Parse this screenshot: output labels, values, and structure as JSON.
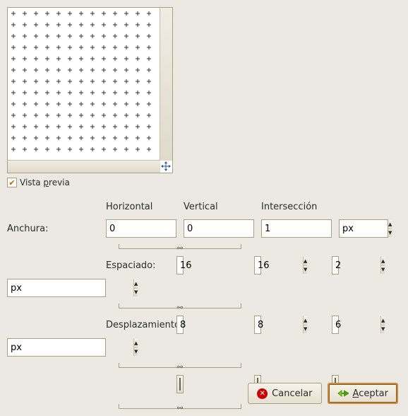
{
  "preview": {
    "checkbox_label_pre": "Vista ",
    "checkbox_label_underlined": "p",
    "checkbox_label_post": "revia",
    "checked": true
  },
  "columns": {
    "horizontal": "Horizontal",
    "vertical": "Vertical",
    "intersection": "Intersección"
  },
  "rows": {
    "width": {
      "label": "Anchura:",
      "horizontal": "0",
      "vertical": "0",
      "intersection": "1",
      "unit": "px"
    },
    "spacing": {
      "label": "Espaciado:",
      "horizontal": "16",
      "vertical": "16",
      "intersection": "2",
      "unit": "px"
    },
    "offset": {
      "label": "Desplazamiento:",
      "horizontal": "8",
      "vertical": "8",
      "intersection": "6",
      "unit": "px"
    }
  },
  "colors": {
    "horizontal": "#000000",
    "vertical": "#000000",
    "intersection": "#000000"
  },
  "buttons": {
    "cancel": "Cancelar",
    "accept_underlined": "A",
    "accept_rest": "ceptar"
  }
}
